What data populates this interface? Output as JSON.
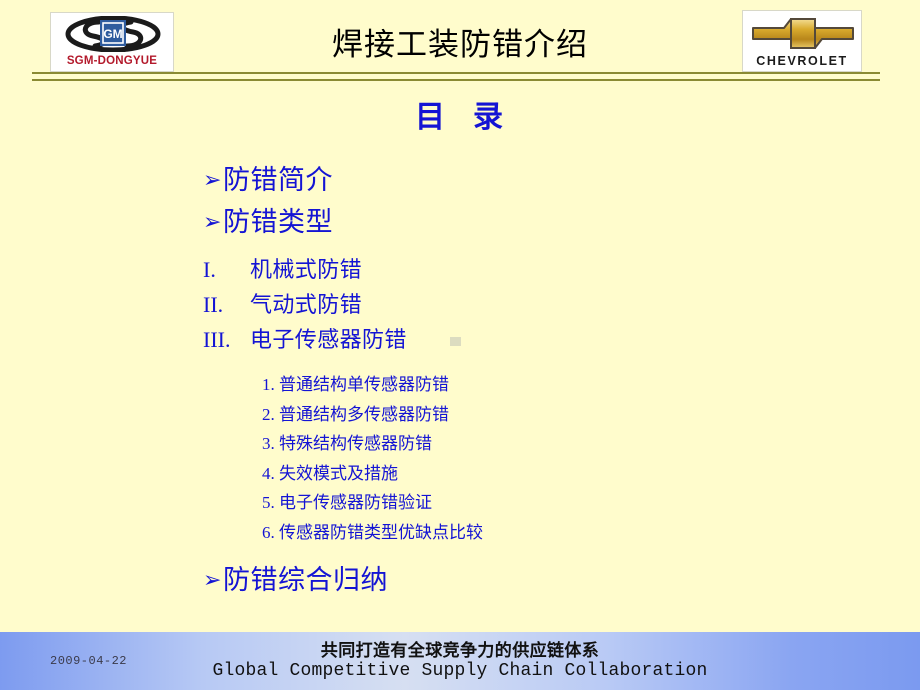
{
  "slide": {
    "background_color": "#fffccc",
    "title": "焊接工装防错介绍",
    "toc_heading_left": "目",
    "toc_heading_right": "录"
  },
  "logos": {
    "left": {
      "name": "SGM-DONGYUE",
      "text": "SGM-DONGYUE",
      "badge_text": "GM",
      "text_color": "#b3192b",
      "badge_color": "#2f5c9e"
    },
    "right": {
      "name": "CHEVROLET",
      "text": "CHEVROLET",
      "text_color": "#1c1c1c",
      "bowtie_color": "#d9ab2e"
    }
  },
  "divider": {
    "color": "#8a8a33"
  },
  "toc": {
    "accent_color": "#1414d4",
    "bullet_glyph": "➢",
    "items": [
      {
        "level": 1,
        "marker": "➢",
        "text": "防错简介"
      },
      {
        "level": 1,
        "marker": "➢",
        "text": "防错类型"
      },
      {
        "level": 2,
        "marker": "I.",
        "text": "机械式防错"
      },
      {
        "level": 2,
        "marker": "II.",
        "text": "气动式防错"
      },
      {
        "level": 2,
        "marker": "III.",
        "text": "电子传感器防错"
      },
      {
        "level": 3,
        "marker": "1.",
        "text": "普通结构单传感器防错"
      },
      {
        "level": 3,
        "marker": "2.",
        "text": "普通结构多传感器防错"
      },
      {
        "level": 3,
        "marker": "3.",
        "text": "特殊结构传感器防错"
      },
      {
        "level": 3,
        "marker": "4.",
        "text": "失效模式及措施"
      },
      {
        "level": 3,
        "marker": "5.",
        "text": "电子传感器防错验证"
      },
      {
        "level": 3,
        "marker": "6.",
        "text": "传感器防错类型优缺点比较"
      },
      {
        "level": 1,
        "marker": "➢",
        "text": "防错综合归纳"
      }
    ]
  },
  "footer": {
    "date": "2009-04-22",
    "line_cn": "共同打造有全球竞争力的供应链体系",
    "line_en": "Global Competitive Supply Chain Collaboration"
  }
}
